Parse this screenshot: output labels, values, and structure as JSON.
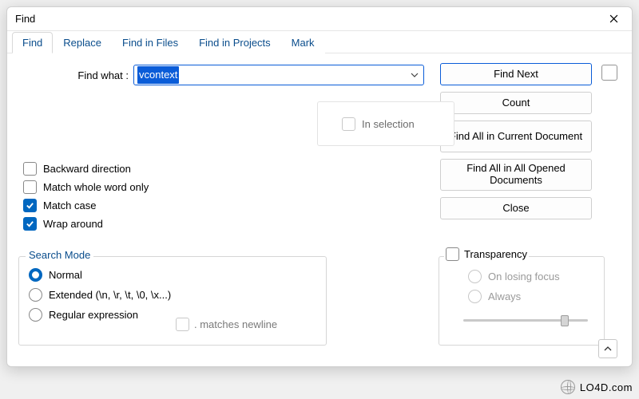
{
  "window": {
    "title": "Find"
  },
  "tabs": [
    {
      "label": "Find",
      "active": true
    },
    {
      "label": "Replace",
      "active": false
    },
    {
      "label": "Find in Files",
      "active": false
    },
    {
      "label": "Find in Projects",
      "active": false
    },
    {
      "label": "Mark",
      "active": false
    }
  ],
  "find": {
    "label": "Find what :",
    "value": "vcontext"
  },
  "in_selection_label": "In selection",
  "actions": {
    "find_next": "Find Next",
    "count": "Count",
    "find_all_current": "Find All in Current Document",
    "find_all_opened": "Find All in All Opened Documents",
    "close": "Close"
  },
  "options": {
    "backward": {
      "label": "Backward direction",
      "checked": false
    },
    "whole_word": {
      "label": "Match whole word only",
      "checked": false
    },
    "match_case": {
      "label": "Match case",
      "checked": true
    },
    "wrap": {
      "label": "Wrap around",
      "checked": true
    }
  },
  "search_mode": {
    "title": "Search Mode",
    "normal": "Normal",
    "extended": "Extended (\\n, \\r, \\t, \\0, \\x...)",
    "regex": "Regular expression",
    "matches_newline": ". matches newline",
    "selected": "normal"
  },
  "transparency": {
    "title": "Transparency",
    "on_losing_focus": "On losing focus",
    "always": "Always",
    "enabled": false,
    "slider_percent": 78
  },
  "watermark": "LO4D.com"
}
